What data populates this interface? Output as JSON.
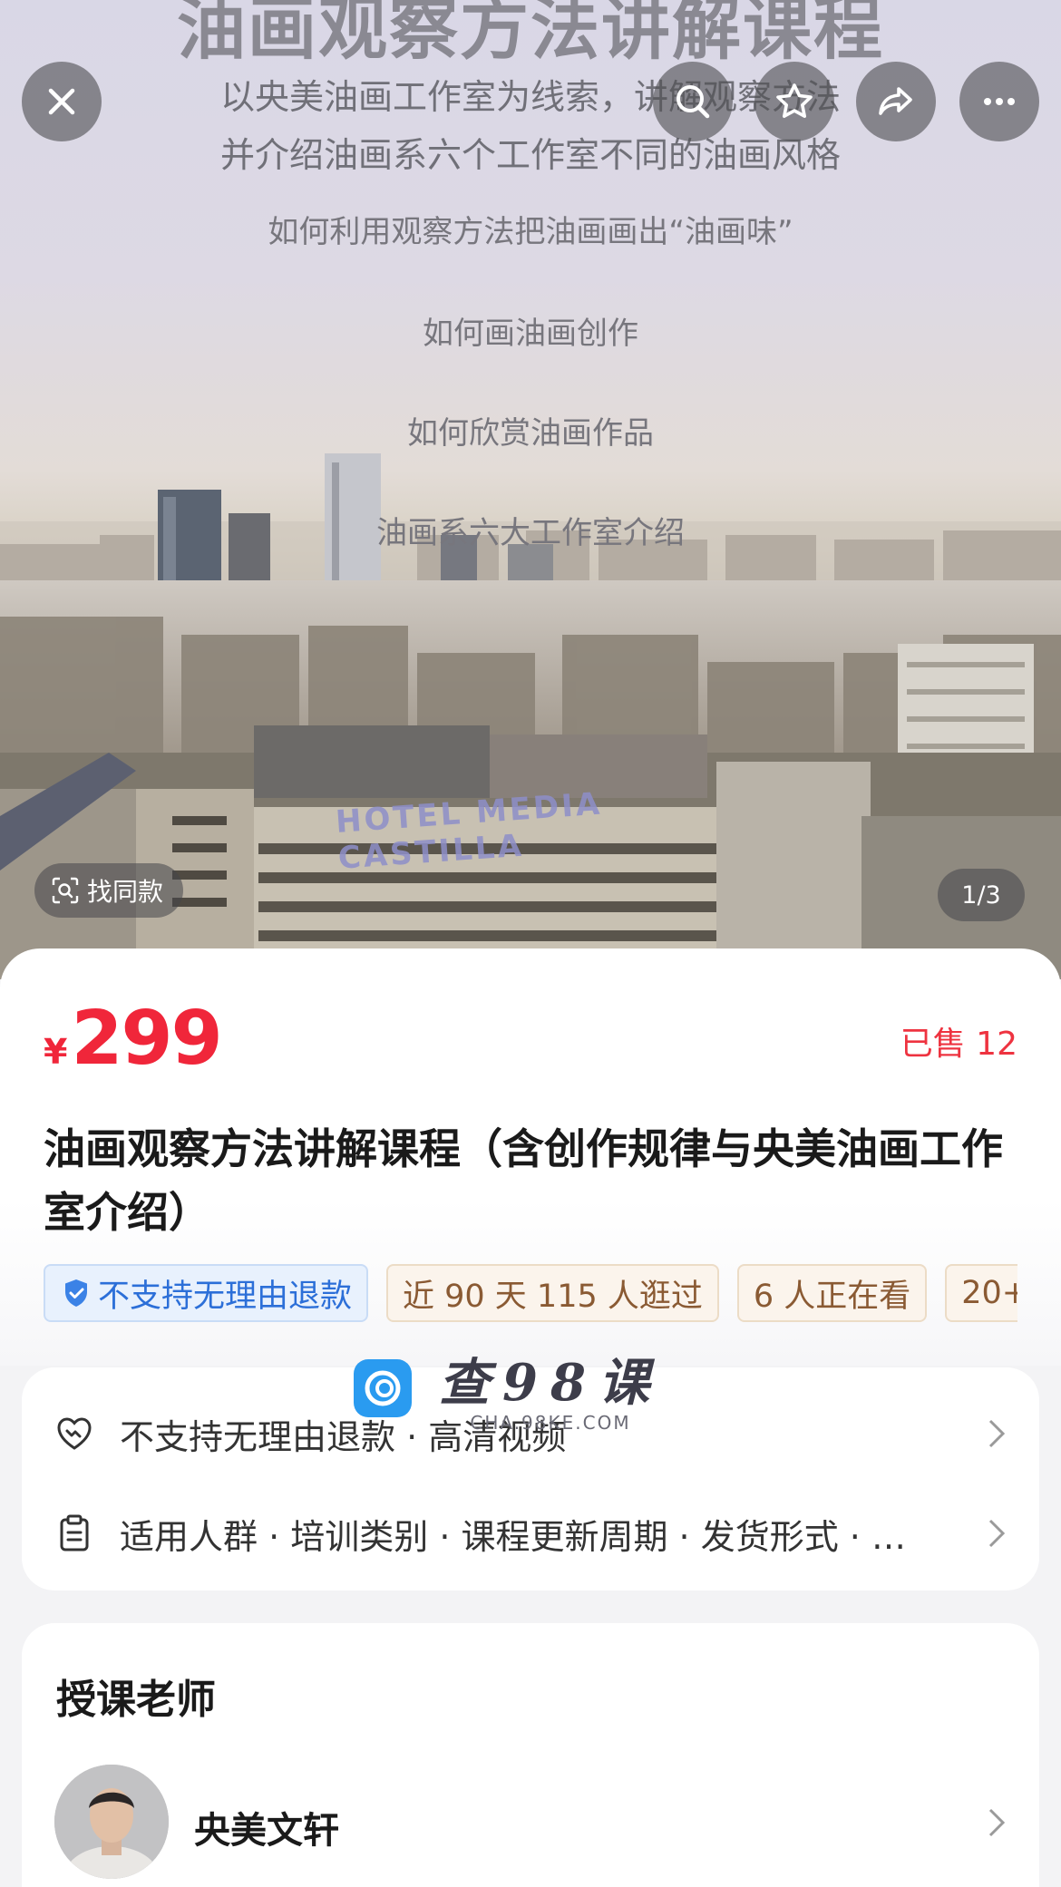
{
  "hero": {
    "title": "油画观察方法讲解课程",
    "subtitle_line1": "以央美油画工作室为线索，讲解观察方法",
    "subtitle_line2": "并介绍油画系六个工作室不同的油画风格",
    "bullets": [
      "如何利用观察方法把油画画出“油画味”",
      "如何画油画创作",
      "如何欣赏油画作品",
      "油画系六大工作室介绍"
    ],
    "roof_sign": "HOTEL MEDIA CASTILLA",
    "find_same_label": "找同款",
    "page_indicator": "1/3"
  },
  "top_buttons": {
    "close": "close-icon",
    "search": "search-icon",
    "favorite": "star-icon",
    "share": "share-icon",
    "more": "more-icon"
  },
  "product": {
    "currency": "¥",
    "price": "299",
    "sold": "已售 12",
    "title": "油画观察方法讲解课程（含创作规律与央美油画工作室介绍）",
    "tags": [
      "不支持无理由退款",
      "近 90 天 115 人逛过",
      "6 人正在看",
      "20+"
    ]
  },
  "watermark": {
    "main": "查98课",
    "sub": "CHA.98KE.COM"
  },
  "service": {
    "row1": "不支持无理由退款 · 高清视频",
    "row2": "适用人群 · 培训类别 · 课程更新周期 · 发货形式 · …"
  },
  "teacher": {
    "heading": "授课老师",
    "name": "央美文轩"
  },
  "colors": {
    "price_red": "#f0263a",
    "tag_blue": "#2c6fd8",
    "tag_tan": "#8a5a33"
  }
}
